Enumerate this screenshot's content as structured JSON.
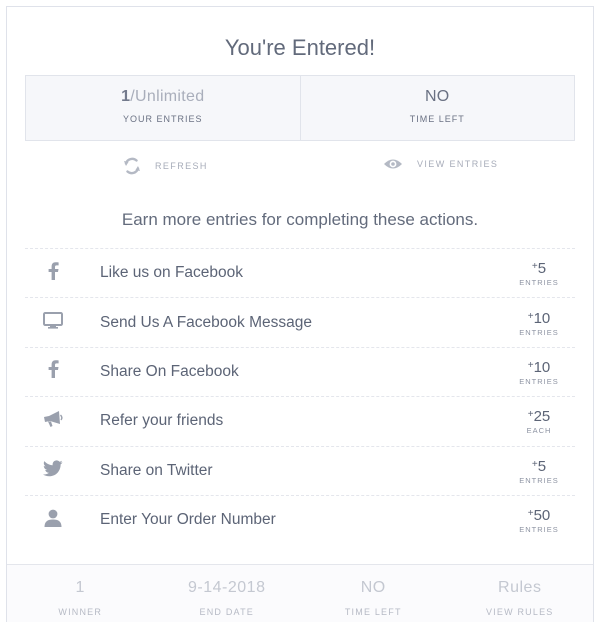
{
  "header": {
    "title": "You're Entered!"
  },
  "stats": {
    "entries_count": "1",
    "entries_sep": "/",
    "entries_limit": "Unlimited",
    "entries_caption": "YOUR ENTRIES",
    "time_value": "NO",
    "time_caption": "TIME LEFT"
  },
  "tools": {
    "refresh_label": "REFRESH",
    "view_entries_label": "VIEW ENTRIES"
  },
  "subtitle": "Earn more entries for completing these actions.",
  "actions": [
    {
      "icon": "facebook-icon",
      "label": "Like us on Facebook",
      "plus": "+",
      "points": "5",
      "unit": "ENTRIES"
    },
    {
      "icon": "monitor-icon",
      "label": "Send Us A Facebook Message",
      "plus": "+",
      "points": "10",
      "unit": "ENTRIES"
    },
    {
      "icon": "facebook-icon",
      "label": "Share On Facebook",
      "plus": "+",
      "points": "10",
      "unit": "ENTRIES"
    },
    {
      "icon": "megaphone-icon",
      "label": "Refer your friends",
      "plus": "+",
      "points": "25",
      "unit": "EACH"
    },
    {
      "icon": "twitter-icon",
      "label": "Share on Twitter",
      "plus": "+",
      "points": "5",
      "unit": "ENTRIES"
    },
    {
      "icon": "user-icon",
      "label": "Enter Your Order Number",
      "plus": "+",
      "points": "50",
      "unit": "ENTRIES"
    }
  ],
  "footer": {
    "winner_value": "1",
    "winner_caption": "WINNER",
    "end_date_value": "9-14-2018",
    "end_date_caption": "END DATE",
    "time_left_value": "NO",
    "time_left_caption": "TIME LEFT",
    "rules_value": "Rules",
    "rules_caption": "VIEW RULES"
  },
  "colors": {
    "text": "#5c6476",
    "muted": "#a9aebb",
    "icon": "#9aa0ad",
    "border": "#e1e4eb",
    "panel": "#f6f7fa"
  }
}
